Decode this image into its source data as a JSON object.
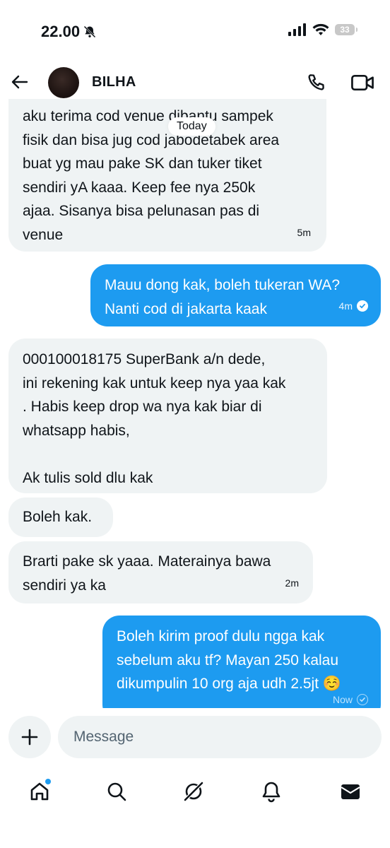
{
  "status_bar": {
    "time": "22.00",
    "battery": "33",
    "icons": [
      "bell-off-icon",
      "cellular-signal-icon",
      "wifi-icon",
      "battery-icon"
    ]
  },
  "header": {
    "contact_name": "BILHA",
    "icons": [
      "back-arrow-icon",
      "phone-icon",
      "video-icon"
    ]
  },
  "date_chip": "Today",
  "messages": [
    {
      "direction": "in",
      "text": "aku terima cod venue dibantu sampek\nfisik dan bisa jug cod jabodetabek area\nbuat yg mau pake SK dan tuker tiket\nsendiri yA kaaa. Keep fee nya 250k\najaa. Sisanya bisa pelunasan pas di\nvenue",
      "time": "5m"
    },
    {
      "direction": "out",
      "text": "Mauu dong kak, boleh tukeran WA?\nNanti cod di jakarta kaak",
      "time": "4m"
    },
    {
      "direction": "in",
      "text": "000100018175 SuperBank a/n dede,\nini rekening kak untuk keep nya yaa kak\n. Habis keep drop wa nya kak biar di\nwhatsapp habis,\n\nAk tulis sold dlu kak",
      "time": ""
    },
    {
      "direction": "in",
      "text": "Boleh kak.",
      "time": ""
    },
    {
      "direction": "in",
      "text": "Brarti pake sk yaaa. Materainya bawa\nsendiri ya ka",
      "time": "2m"
    },
    {
      "direction": "out",
      "text": "Boleh kirim proof dulu ngga kak\nsebelum aku tf? Mayan 250 kalau\ndikumpulin 10 org aja udh 2.5jt ☺️",
      "time": "Now"
    }
  ],
  "composer": {
    "placeholder": "Message",
    "icons": [
      "plus-icon"
    ]
  },
  "tab_bar": {
    "items": [
      "home-icon",
      "search-icon",
      "grok-icon",
      "notifications-icon",
      "messages-icon"
    ]
  },
  "colors": {
    "accent": "#1d9bf0",
    "incoming_bubble": "#eff3f4",
    "text": "#0f1419"
  }
}
